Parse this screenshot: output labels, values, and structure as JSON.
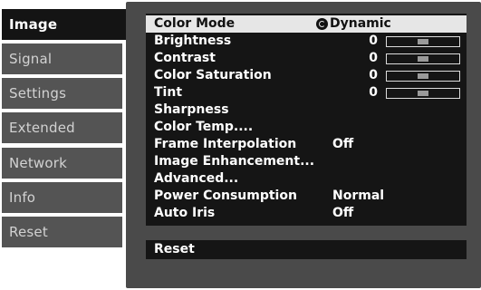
{
  "tabs": [
    {
      "label": "Image",
      "active": true
    },
    {
      "label": "Signal",
      "active": false
    },
    {
      "label": "Settings",
      "active": false
    },
    {
      "label": "Extended",
      "active": false
    },
    {
      "label": "Network",
      "active": false
    },
    {
      "label": "Info",
      "active": false
    },
    {
      "label": "Reset",
      "active": false
    }
  ],
  "menu": {
    "color_mode": {
      "label": "Color Mode",
      "value": "Dynamic",
      "icon": "dynamic-mode-icon"
    },
    "brightness": {
      "label": "Brightness",
      "value": "0",
      "level": 0.5
    },
    "contrast": {
      "label": "Contrast",
      "value": "0",
      "level": 0.5
    },
    "color_saturation": {
      "label": "Color Saturation",
      "value": "0",
      "level": 0.5
    },
    "tint": {
      "label": "Tint",
      "value": "0",
      "level": 0.5
    },
    "sharpness": {
      "label": "Sharpness"
    },
    "color_temp": {
      "label": "Color Temp...."
    },
    "frame_interpolation": {
      "label": "Frame Interpolation",
      "value": "Off"
    },
    "image_enhancement": {
      "label": "Image Enhancement..."
    },
    "advanced": {
      "label": "Advanced..."
    },
    "power_consumption": {
      "label": "Power Consumption",
      "value": "Normal"
    },
    "auto_iris": {
      "label": "Auto Iris",
      "value": "Off"
    }
  },
  "reset_label": "Reset",
  "colors": {
    "active_tab": "#141414",
    "inactive_tab": "#545454",
    "panel": "#4a4a4a",
    "menu_bg": "#151515",
    "highlight": "#e6e6e6"
  }
}
